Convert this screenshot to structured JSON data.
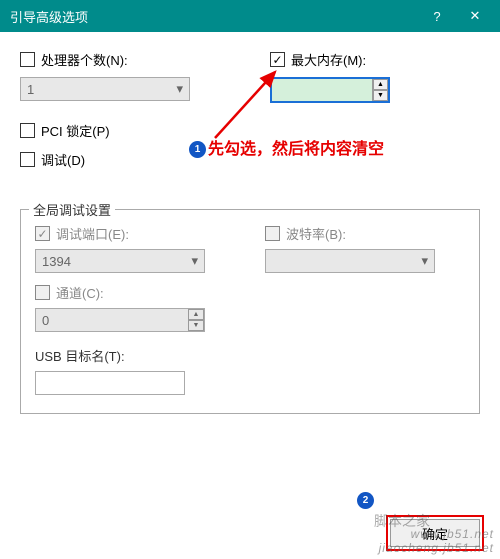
{
  "window": {
    "title": "引导高级选项"
  },
  "options": {
    "processor_count": {
      "label": "处理器个数(N):",
      "checked": false,
      "value": "1"
    },
    "max_memory": {
      "label": "最大内存(M):",
      "checked": true,
      "value": ""
    },
    "pci_lock": {
      "label": "PCI 锁定(P)",
      "checked": false
    },
    "debug": {
      "label": "调试(D)",
      "checked": false
    }
  },
  "global_debug": {
    "legend": "全局调试设置",
    "debug_port": {
      "label": "调试端口(E):",
      "checked": true,
      "value": "1394"
    },
    "baud_rate": {
      "label": "波特率(B):",
      "checked": false,
      "value": ""
    },
    "channel": {
      "label": "通道(C):",
      "checked": false,
      "value": "0"
    },
    "usb_target": {
      "label": "USB 目标名(T):",
      "value": ""
    }
  },
  "annotation": {
    "badge1": "1",
    "badge2": "2",
    "text": "先勾选，然后将内容清空"
  },
  "buttons": {
    "ok": "确定"
  },
  "watermark": {
    "line1": "脚本之家",
    "line2": "www.jb51.net",
    "line3": "jiaocheng.jb51.net"
  }
}
